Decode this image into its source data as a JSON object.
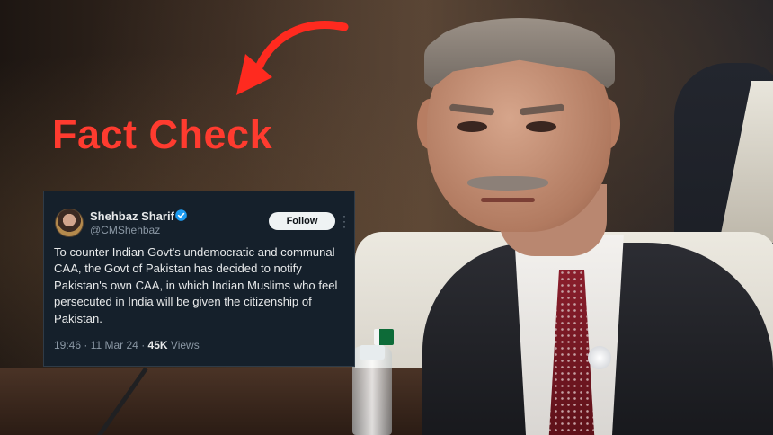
{
  "overlay": {
    "headline": "Fact Check",
    "headline_color": "#ff3b2f",
    "arrow_icon": "curved-arrow-icon"
  },
  "tweet": {
    "display_name": "Shehbaz Sharif",
    "handle": "@CMShehbaz",
    "verified_icon": "verified-badge-icon",
    "follow_label": "Follow",
    "more_icon": "more-options-icon",
    "text": "To counter Indian Govt's undemocratic and communal CAA, the Govt of Pakistan has decided to notify Pakistan's own CAA, in which Indian Muslims who feel persecuted in India will be given the citizenship of Pakistan.",
    "time": "19:46",
    "date": "11 Mar 24",
    "views_count": "45K",
    "views_label": "Views",
    "background_color": "#15202b",
    "verified_color": "#1d9bf0"
  }
}
